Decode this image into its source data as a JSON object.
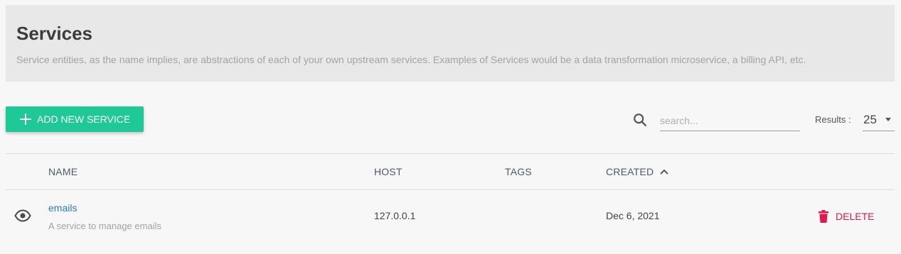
{
  "header": {
    "title": "Services",
    "description": "Service entities, as the name implies, are abstractions of each of your own upstream services. Examples of Services would be a data transformation microservice, a billing API, etc."
  },
  "toolbar": {
    "add_button_label": "ADD NEW SERVICE",
    "search_placeholder": "search...",
    "search_value": "",
    "results_label": "Results :",
    "results_value": "25",
    "accent_color": "#1ec997"
  },
  "table": {
    "columns": {
      "name": "NAME",
      "host": "HOST",
      "tags": "TAGS",
      "created": "CREATED"
    },
    "sort": {
      "column": "created",
      "direction": "ascending",
      "icon": "chevron-up-icon"
    },
    "rows": [
      {
        "name": "emails",
        "description": "A service to manage emails",
        "host": "127.0.0.1",
        "tags": "",
        "created": "Dec 6, 2021",
        "view_icon": "eye-icon",
        "delete_label": "DELETE",
        "delete_icon": "trash-icon",
        "delete_color": "#e0194e",
        "link_color": "#2b7bc4"
      }
    ]
  }
}
